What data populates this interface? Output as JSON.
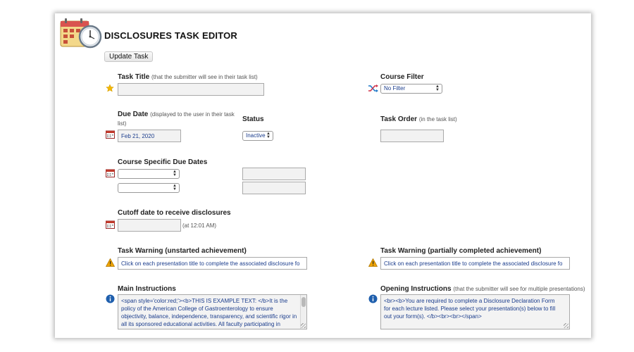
{
  "header": {
    "title": "DISCLOSURES TASK EDITOR",
    "icon": "calendar-clock-icon"
  },
  "toolbar": {
    "update_label": "Update Task"
  },
  "form": {
    "task_title": {
      "label": "Task Title",
      "hint": "(that the submitter will see in their task list)",
      "value": ""
    },
    "course_filter": {
      "label": "Course Filter",
      "value": "No Filter"
    },
    "due_date": {
      "label": "Due Date",
      "hint": "(displayed to the user in their task list)",
      "value": "Feb 21, 2020"
    },
    "status": {
      "label": "Status",
      "value": "Inactive"
    },
    "task_order": {
      "label": "Task Order",
      "hint": "(in the task list)",
      "value": ""
    },
    "course_due_dates": {
      "label": "Course Specific Due Dates",
      "rows": [
        {
          "course": "",
          "date": ""
        },
        {
          "course": "",
          "date": ""
        }
      ]
    },
    "cutoff": {
      "label": "Cutoff date to receive disclosures",
      "value": "",
      "suffix": "(at 12:01 AM)"
    },
    "warning_unstarted": {
      "label": "Task Warning (unstarted achievement)",
      "value": "Click on each presentation title to complete the associated disclosure fo"
    },
    "warning_partial": {
      "label": "Task Warning (partially completed achievement)",
      "value": "Click on each presentation title to complete the associated disclosure fo"
    },
    "main_instructions": {
      "label": "Main Instructions",
      "value": "<span style='color:red;'><b>THIS IS EXAMPLE TEXT: </b>It is the policy of the American College of Gastroenterology to ensure objectivity, balance, independence, transparency, and scientific rigor in all its sponsored educational activities. All faculty participating in"
    },
    "opening_instructions": {
      "label": "Opening Instructions",
      "hint": "(that the submitter will see for multiple presentations)",
      "value": "<br><b>You are required to complete a Disclosure Declaration Form for each lecture listed. Please select your presentation(s) below to fill out your form(s). </b><br><br></span>"
    }
  },
  "colors": {
    "accent_text": "#1a3c8c",
    "star": "#f2b705",
    "warning": "#f0a400",
    "info": "#1f5fad",
    "filter_icon": "#1f78c8"
  }
}
